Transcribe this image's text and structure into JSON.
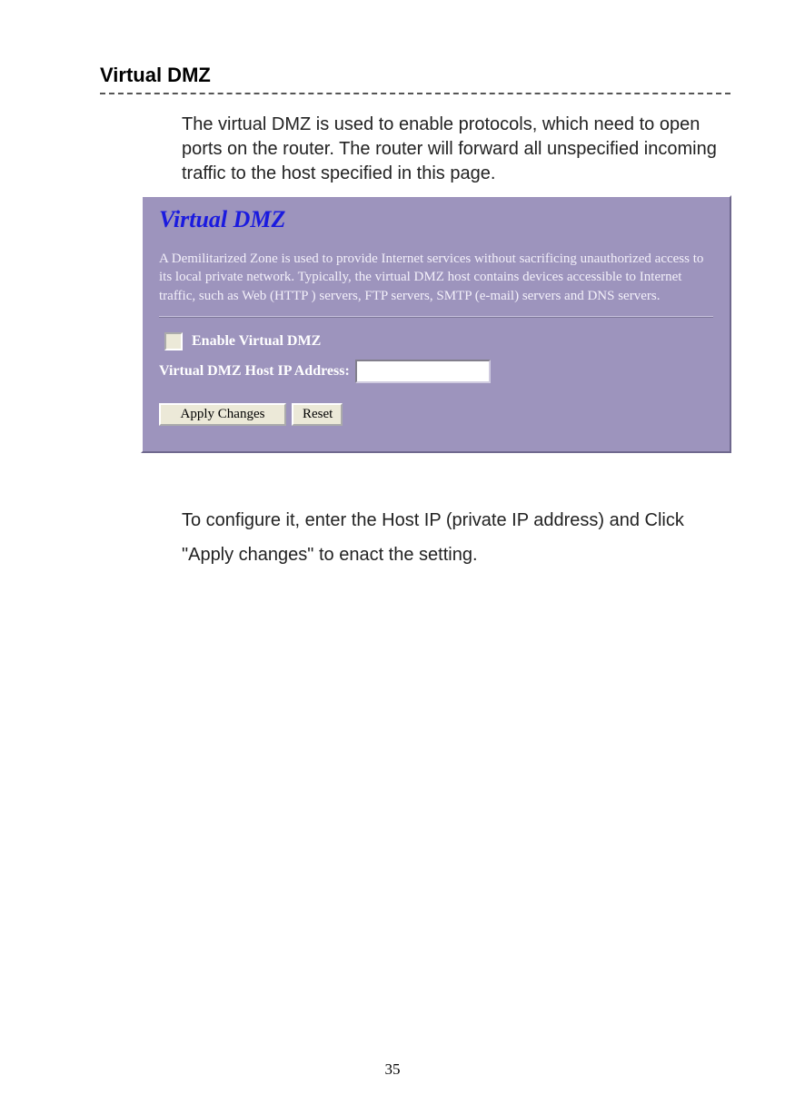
{
  "section": {
    "heading": "Virtual DMZ",
    "intro": "The virtual DMZ is used to enable protocols, which need to open ports on the router. The router will forward all unspecified incoming traffic to the host specified in this page."
  },
  "panel": {
    "title": "Virtual DMZ",
    "description": "A Demilitarized Zone is used to provide Internet services without sacrificing unauthorized access to its local private network. Typically, the virtual DMZ host contains devices accessible to Internet traffic, such as Web (HTTP ) servers, FTP servers, SMTP (e-mail) servers and DNS servers.",
    "enable_label": "Enable Virtual DMZ",
    "ip_label": "Virtual DMZ Host IP Address:",
    "ip_value": "",
    "apply_label": "Apply Changes",
    "reset_label": "Reset"
  },
  "followup": "To configure it, enter the Host IP (private IP address) and Click \"Apply changes\" to enact the setting.",
  "page_number": "35"
}
